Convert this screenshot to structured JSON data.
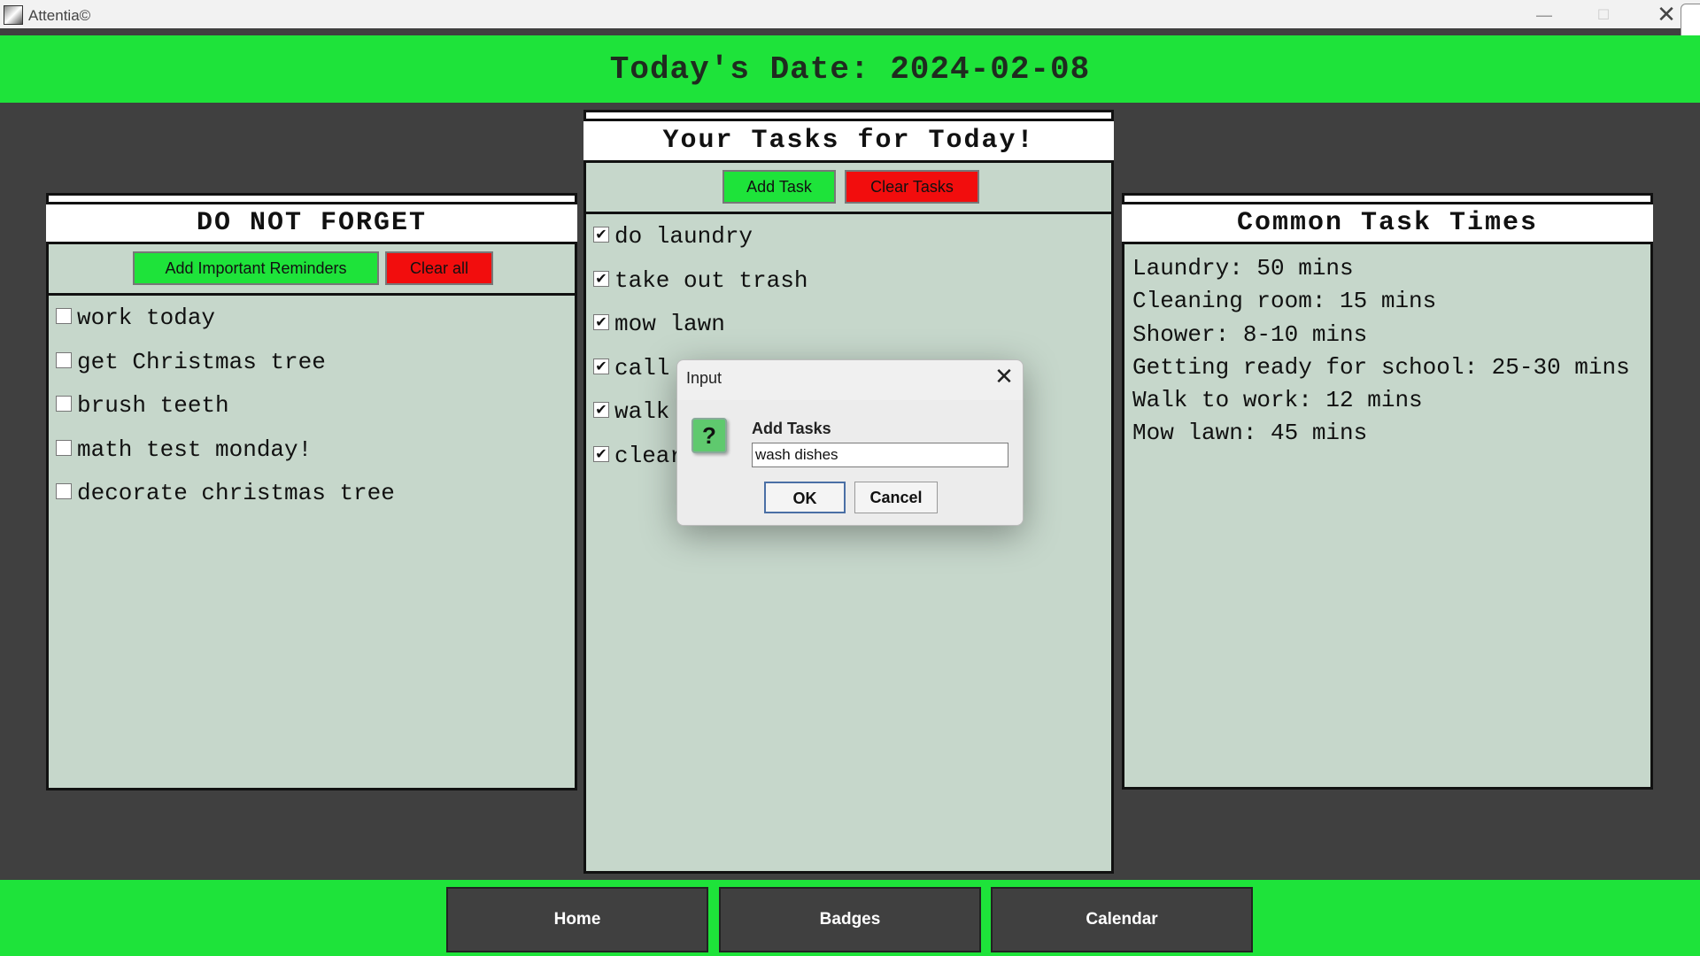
{
  "window": {
    "title": "Attentia©",
    "minimize_icon": "—",
    "maximize_icon": "☐",
    "close_icon": "✕"
  },
  "header": {
    "date_text": "Today's Date: 2024-02-08"
  },
  "reminders_panel": {
    "title": "DO NOT FORGET",
    "add_button": "Add Important Reminders",
    "clear_button": "Clear all",
    "items": [
      {
        "label": "work today",
        "checked": false
      },
      {
        "label": "get Christmas tree",
        "checked": false
      },
      {
        "label": "brush teeth",
        "checked": false
      },
      {
        "label": "math test monday!",
        "checked": false
      },
      {
        "label": "decorate christmas tree",
        "checked": false
      }
    ]
  },
  "tasks_panel": {
    "title": "Your Tasks for Today!",
    "add_button": "Add Task",
    "clear_button": "Clear Tasks",
    "items": [
      {
        "label": "do laundry",
        "checked": true
      },
      {
        "label": "take out trash",
        "checked": true
      },
      {
        "label": "mow lawn",
        "checked": true
      },
      {
        "label": "call",
        "checked": true
      },
      {
        "label": "walk",
        "checked": true
      },
      {
        "label": "clear",
        "checked": true
      }
    ]
  },
  "times_panel": {
    "title": "Common Task Times",
    "items": [
      "Laundry: 50 mins",
      "Cleaning room: 15 mins",
      "Shower: 8-10 mins",
      "Getting ready for school: 25-30 mins",
      "Walk to work: 12 mins",
      "Mow lawn: 45 mins"
    ]
  },
  "footer": {
    "nav": [
      "Home",
      "Badges",
      "Calendar"
    ]
  },
  "dialog": {
    "title": "Input",
    "close_icon": "✕",
    "icon_glyph": "?",
    "label": "Add Tasks",
    "input_value": "wash dishes",
    "ok_label": "OK",
    "cancel_label": "Cancel"
  },
  "colors": {
    "accent_green": "#1ee33a",
    "danger_red": "#f20d0d",
    "panel_bg": "#c6d7cb",
    "app_bg": "#404040"
  }
}
